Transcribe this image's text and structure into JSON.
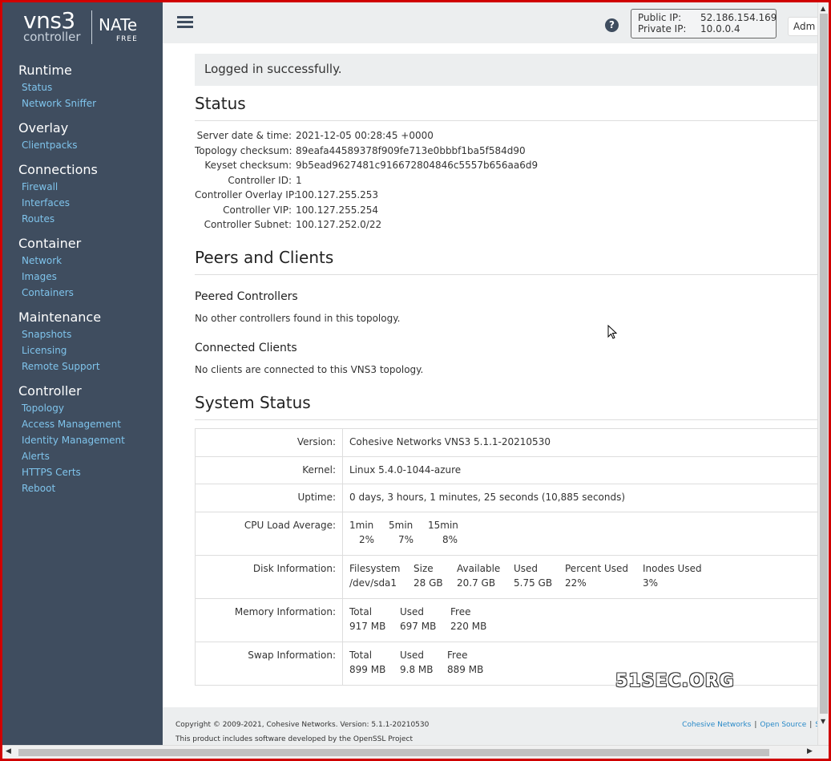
{
  "sidebar": {
    "logo": {
      "brand": "vns3",
      "sub": "controller",
      "edition": "NATe",
      "tier": "FREE"
    },
    "sections": [
      {
        "heading": "Runtime",
        "items": [
          "Status",
          "Network Sniffer"
        ]
      },
      {
        "heading": "Overlay",
        "items": [
          "Clientpacks"
        ]
      },
      {
        "heading": "Connections",
        "items": [
          "Firewall",
          "Interfaces",
          "Routes"
        ]
      },
      {
        "heading": "Container",
        "items": [
          "Network",
          "Images",
          "Containers"
        ]
      },
      {
        "heading": "Maintenance",
        "items": [
          "Snapshots",
          "Licensing",
          "Remote Support"
        ]
      },
      {
        "heading": "Controller",
        "items": [
          "Topology",
          "Access Management",
          "Identity Management",
          "Alerts",
          "HTTPS Certs",
          "Reboot"
        ]
      }
    ]
  },
  "topbar": {
    "help_glyph": "?",
    "public_ip_label": "Public IP:",
    "public_ip": "52.186.154.169",
    "private_ip_label": "Private IP:",
    "private_ip": "10.0.0.4",
    "admin_label": "Adm"
  },
  "alert": "Logged in successfully.",
  "status": {
    "title": "Status",
    "rows": [
      {
        "k": "Server date & time:",
        "v": "2021-12-05 00:28:45 +0000"
      },
      {
        "k": "Topology checksum:",
        "v": "89eafa44589378f909fe713e0bbbf1ba5f584d90"
      },
      {
        "k": "Keyset checksum:",
        "v": "9b5ead9627481c916672804846c5557b656aa6d9"
      },
      {
        "k": "Controller ID:",
        "v": "1"
      },
      {
        "k": "Controller Overlay IP:",
        "v": "100.127.255.253"
      },
      {
        "k": "Controller VIP:",
        "v": "100.127.255.254"
      },
      {
        "k": "Controller Subnet:",
        "v": "100.127.252.0/22"
      }
    ]
  },
  "peers": {
    "title": "Peers and Clients",
    "peered_heading": "Peered Controllers",
    "peered_text": "No other controllers found in this topology.",
    "clients_heading": "Connected Clients",
    "clients_text": "No clients are connected to this VNS3 topology."
  },
  "system": {
    "title": "System Status",
    "version_label": "Version:",
    "version": "Cohesive Networks VNS3 5.1.1-20210530",
    "kernel_label": "Kernel:",
    "kernel": "Linux 5.4.0-1044-azure",
    "uptime_label": "Uptime:",
    "uptime": "0 days, 3 hours, 1 minutes, 25 seconds (10,885 seconds)",
    "cpu_label": "CPU Load Average:",
    "cpu": {
      "h1": "1min",
      "h2": "5min",
      "h3": "15min",
      "v1": "2%",
      "v2": "7%",
      "v3": "8%"
    },
    "disk_label": "Disk Information:",
    "disk": {
      "h": [
        "Filesystem",
        "Size",
        "Available",
        "Used",
        "Percent Used",
        "Inodes Used"
      ],
      "v": [
        "/dev/sda1",
        "28 GB",
        "20.7 GB",
        "5.75 GB",
        "22%",
        "3%"
      ]
    },
    "mem_label": "Memory Information:",
    "mem": {
      "h": [
        "Total",
        "Used",
        "Free"
      ],
      "v": [
        "917 MB",
        "697 MB",
        "220 MB"
      ]
    },
    "swap_label": "Swap Information:",
    "swap": {
      "h": [
        "Total",
        "Used",
        "Free"
      ],
      "v": [
        "899 MB",
        "9.8 MB",
        "889 MB"
      ]
    }
  },
  "footer": {
    "copyright": "Copyright © 2009-2021, Cohesive Networks. Version: 5.1.1-20210530",
    "openssl": "This product includes software developed by the OpenSSL Project",
    "link1": "Cohesive Networks",
    "link2": "Open Source",
    "link3": "S"
  },
  "watermark": "51SEC.ORG"
}
